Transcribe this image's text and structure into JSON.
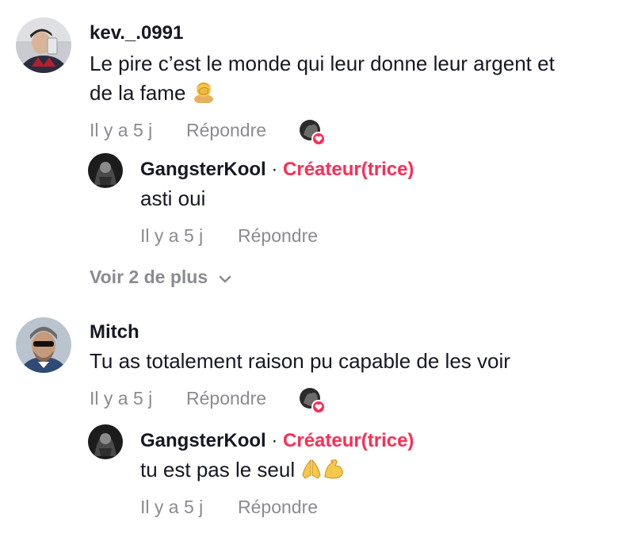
{
  "comments": [
    {
      "username": "kev._.0991",
      "text_line1": "Le pire c’est le monde qui leur donne leur argent et",
      "text_line2": "de la fame",
      "emoji": "person-facepalming",
      "time": "Il y a 5 j",
      "reply_label": "Répondre",
      "reply": {
        "username": "GangsterKool",
        "separator": "·",
        "badge": "Créateur(trice)",
        "text": "asti oui",
        "time": "Il y a 5 j",
        "reply_label": "Répondre"
      },
      "more_label": "Voir 2 de plus"
    },
    {
      "username": "Mitch",
      "text_line1": "Tu as totalement raison pu capable de les voir",
      "time": "Il y a 5 j",
      "reply_label": "Répondre",
      "reply": {
        "username": "GangsterKool",
        "separator": "·",
        "badge": "Créateur(trice)",
        "text": "tu est pas le seul",
        "emojis": [
          "folded-hands",
          "flexed-biceps"
        ],
        "time": "Il y a 5 j",
        "reply_label": "Répondre"
      }
    }
  ],
  "colors": {
    "creator": "#fe2c55",
    "muted": "#8a8b91",
    "text": "#161823",
    "like_badge": "#fe2c55"
  }
}
